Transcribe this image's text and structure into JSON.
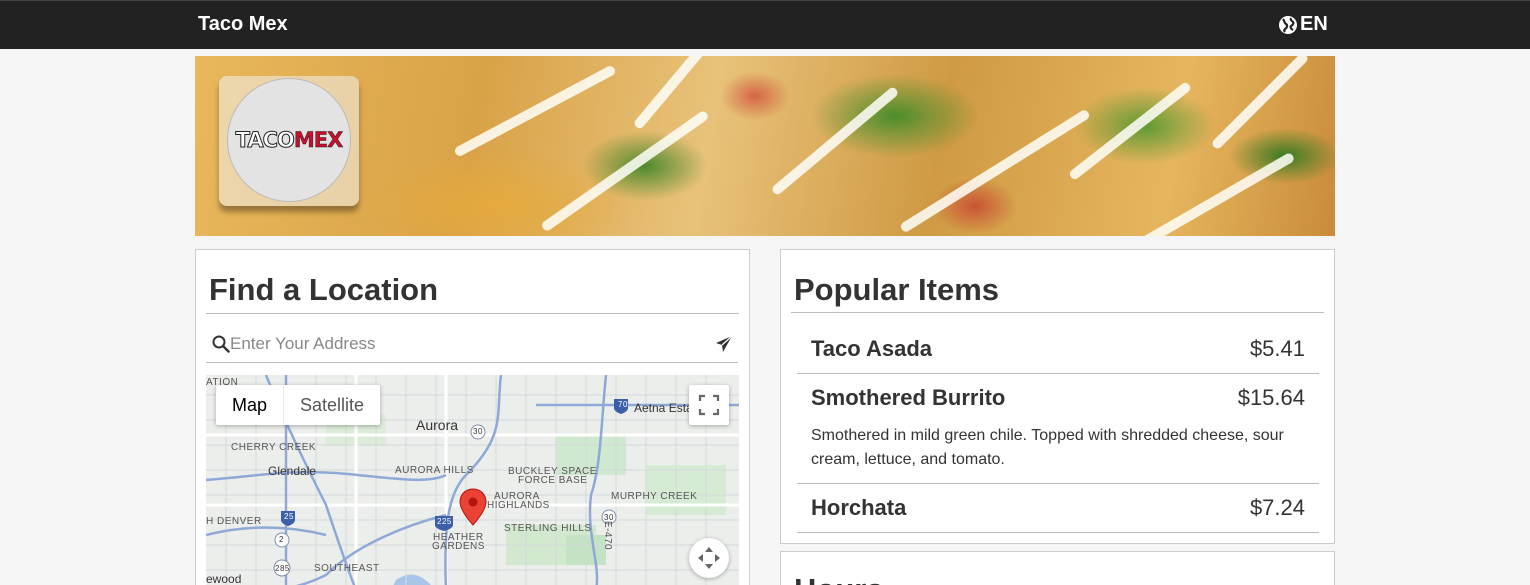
{
  "header": {
    "brand": "Taco Mex",
    "language": "EN",
    "language_icon": "globe-icon"
  },
  "hero": {
    "logo_text_left": "TACO",
    "logo_text_right": "MEX"
  },
  "location": {
    "title": "Find a Location",
    "search_placeholder": "Enter Your Address",
    "search_icon": "search-icon",
    "locate_icon": "send-icon",
    "map": {
      "type_options": [
        "Map",
        "Satellite"
      ],
      "selected_type": "Map",
      "labels": {
        "l1": "ATION",
        "l2": "Aurora",
        "l3": "CHERRY CREEK",
        "l4": "Glendale",
        "l5": "AURORA HILLS",
        "l6": "BUCKLEY SPACE",
        "l7": "FORCE BASE",
        "l8": "AURORA",
        "l9": "HIGHLANDS",
        "l10": "MURPHY CREEK",
        "l11": "H DENVER",
        "l12": "STERLING HILLS",
        "l13": "HEATHER",
        "l14": "GARDENS",
        "l15": "SOUTHEAST",
        "l16": "ewood",
        "l17": "Aetna Esta",
        "l18": "E-470"
      },
      "shields": {
        "s1": "70",
        "s2": "30",
        "s3": "25",
        "s4": "225",
        "s5": "2",
        "s6": "285",
        "s7": "30"
      }
    }
  },
  "popular": {
    "title": "Popular Items",
    "items": [
      {
        "name": "Taco Asada",
        "price": "$5.41",
        "description": ""
      },
      {
        "name": "Smothered Burrito",
        "price": "$15.64",
        "description": "Smothered in mild green chile. Topped with shredded cheese, sour cream, lettuce, and tomato."
      },
      {
        "name": "Horchata",
        "price": "$7.24",
        "description": ""
      }
    ]
  },
  "hours": {
    "title": "Hours"
  }
}
